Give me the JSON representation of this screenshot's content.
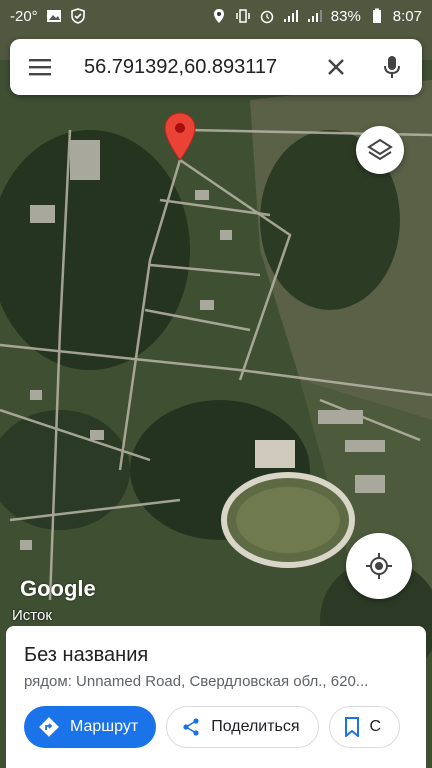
{
  "status_bar": {
    "temperature": "-20°",
    "battery": "83%",
    "time": "8:07"
  },
  "search": {
    "query": "56.791392,60.893117"
  },
  "map": {
    "logo": "Google",
    "place_label": "Исток"
  },
  "place_card": {
    "title": "Без названия",
    "subtitle": "рядом: Unnamed Road, Свердловская обл., 620...",
    "actions": [
      {
        "label": "Маршрут",
        "icon": "directions-icon"
      },
      {
        "label": "Поделиться",
        "icon": "share-icon"
      },
      {
        "label": "С",
        "icon": "bookmark-icon"
      }
    ]
  },
  "colors": {
    "accent": "#1a73e8",
    "pin": "#ea4335"
  }
}
